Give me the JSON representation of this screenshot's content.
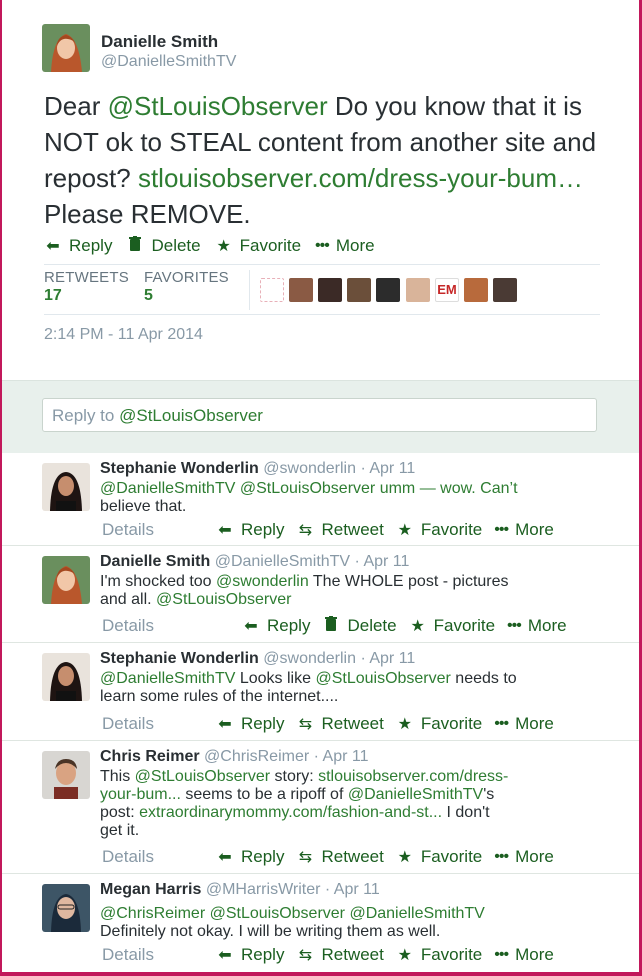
{
  "main_tweet": {
    "author_name": "Danielle Smith",
    "author_handle": "@DanielleSmithTV",
    "text_prefix": "Dear ",
    "mention": "@StLouisObserver",
    "text_mid": " Do you know that it is NOT ok to STEAL content from another site and repost? ",
    "link": "stlouisobserver.com/dress-your-bum…",
    "text_suffix": " Please REMOVE.",
    "actions": {
      "reply": "Reply",
      "delete": "Delete",
      "favorite": "Favorite",
      "more": "More"
    },
    "stats": {
      "retweets_label": "RETWEETS",
      "retweets_value": "17",
      "favorites_label": "FAVORITES",
      "favorites_value": "5"
    },
    "em_badge": "EM",
    "timestamp": "2:14 PM - 11 Apr 2014"
  },
  "reply_box": {
    "placeholder_prefix": "Reply to ",
    "placeholder_mention": "@StLouisObserver"
  },
  "colors": {
    "accent": "#2e7d32",
    "frame": "#c2185b",
    "panel": "#e8f0ec"
  },
  "replies": [
    {
      "name": "Stephanie Wonderlin",
      "handle": "@swonderlin",
      "time": "Apr 11",
      "line1": "@DanielleSmithTV @StLouisObserver umm — wow.  Can’t",
      "line2": "believe that.",
      "details": "Details",
      "reply": "Reply",
      "retweet": "Retweet",
      "favorite": "Favorite",
      "more": "More"
    },
    {
      "name": "Danielle Smith",
      "handle": "@DanielleSmithTV",
      "time": "Apr 11",
      "line1_pre": "I'm shocked too ",
      "line1_m": "@swonderlin",
      "line1_post": " The WHOLE post - pictures",
      "line2_pre": "and all. ",
      "line2_m": "@StLouisObserver",
      "details": "Details",
      "reply": "Reply",
      "delete": "Delete",
      "favorite": "Favorite",
      "more": "More"
    },
    {
      "name": "Stephanie Wonderlin",
      "handle": "@swonderlin",
      "time": "Apr 11",
      "line1_m1": "@DanielleSmithTV",
      "line1_mid": " Looks like ",
      "line1_m2": "@StLouisObserver",
      "line1_post": " needs to",
      "line2": "learn some rules of the internet....",
      "details": "Details",
      "reply": "Reply",
      "retweet": "Retweet",
      "favorite": "Favorite",
      "more": "More"
    },
    {
      "name": "Chris Reimer",
      "handle": "@ChrisReimer",
      "time": "Apr 11",
      "l1_pre": "This ",
      "l1_m": "@StLouisObserver",
      "l1_mid": " story: ",
      "l1_link": "stlouisobserver.com/dress-",
      "l2_link": "your-bum...",
      "l2_mid": " seems to be a ripoff of ",
      "l2_m": "@DanielleSmithTV",
      "l2_post": "'s",
      "l3_pre": "post: ",
      "l3_link": "extraordinarymommy.com/fashion-and-st...",
      "l3_post": " I don't",
      "l4": "get it.",
      "details": "Details",
      "reply": "Reply",
      "retweet": "Retweet",
      "favorite": "Favorite",
      "more": "More"
    },
    {
      "name": "Megan Harris",
      "handle": "@MHarrisWriter",
      "time": "Apr 11",
      "l1_m1": "@ChrisReimer",
      "l1_m2": "@StLouisObserver",
      "l1_m3": "@DanielleSmithTV",
      "l2": "Definitely not okay. I will be writing them as well.",
      "details": "Details",
      "reply": "Reply",
      "retweet": "Retweet",
      "favorite": "Favorite",
      "more": "More"
    }
  ]
}
